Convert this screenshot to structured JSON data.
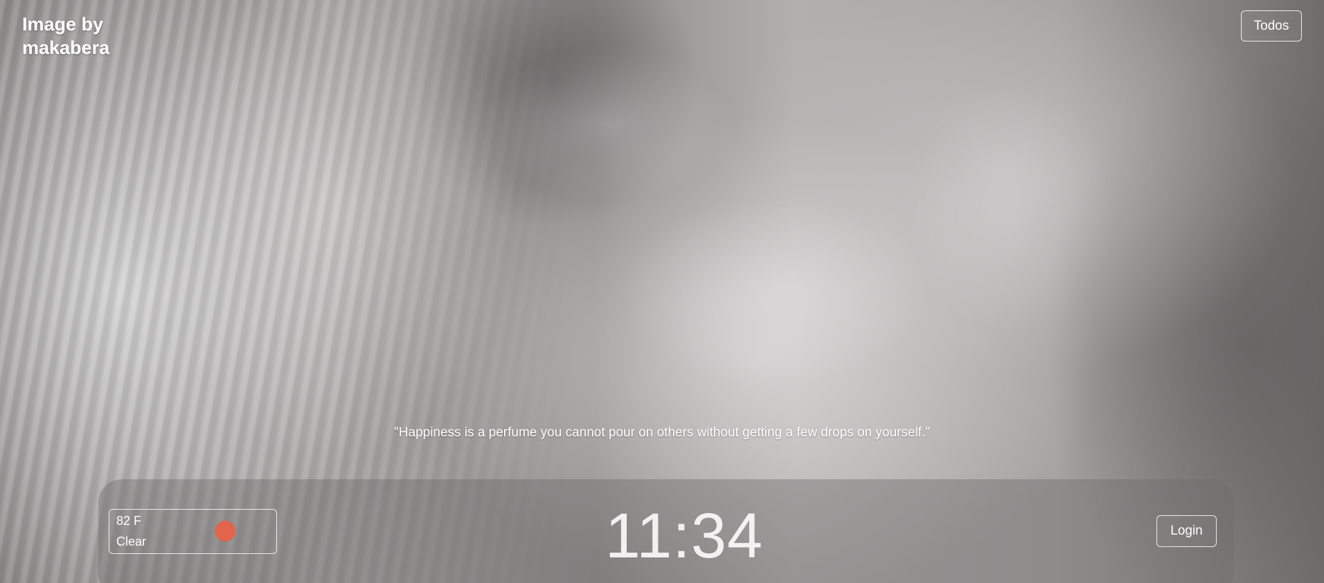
{
  "background": {
    "photo_subject": "waterfall-mist"
  },
  "credit": {
    "text": "Image by makabera"
  },
  "header": {
    "todos_label": "Todos"
  },
  "quote": {
    "text": "\"Happiness is a perfume you cannot pour on others without getting a few drops on yourself.\""
  },
  "weather": {
    "temperature": "82 F",
    "condition": "Clear",
    "icon": "sun-icon",
    "icon_color": "#e0654b"
  },
  "clock": {
    "time": "11:34"
  },
  "auth": {
    "login_label": "Login"
  }
}
